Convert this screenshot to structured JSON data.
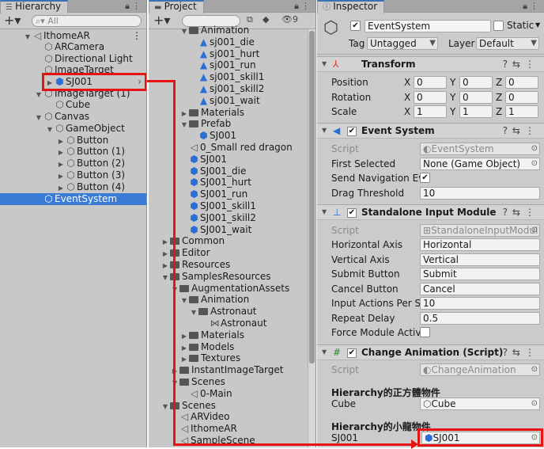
{
  "hierarchy": {
    "tab_label": "Hierarchy",
    "search_placeholder": "All",
    "rows": [
      {
        "label": "IthomeAR",
        "icon": "unity-scene-icon"
      },
      {
        "label": "ARCamera",
        "icon": "gameobject-cube-icon"
      },
      {
        "label": "Directional Light",
        "icon": "gameobject-cube-icon"
      },
      {
        "label": "ImageTarget",
        "icon": "gameobject-cube-icon"
      },
      {
        "label": "SJ001",
        "icon": "prefab-cube-icon"
      },
      {
        "label": "ImageTarget (1)",
        "icon": "gameobject-cube-icon"
      },
      {
        "label": "Cube",
        "icon": "gameobject-cube-icon"
      },
      {
        "label": "Canvas",
        "icon": "gameobject-cube-icon"
      },
      {
        "label": "GameObject",
        "icon": "gameobject-cube-icon"
      },
      {
        "label": "Button",
        "icon": "gameobject-cube-icon"
      },
      {
        "label": "Button (1)",
        "icon": "gameobject-cube-icon"
      },
      {
        "label": "Button (2)",
        "icon": "gameobject-cube-icon"
      },
      {
        "label": "Button (3)",
        "icon": "gameobject-cube-icon"
      },
      {
        "label": "Button (4)",
        "icon": "gameobject-cube-icon"
      },
      {
        "label": "EventSystem",
        "icon": "gameobject-cube-icon"
      }
    ]
  },
  "project": {
    "tab_label": "Project",
    "hidden_count": "9",
    "rows": [
      {
        "label": "Animation",
        "icon": "folder-icon"
      },
      {
        "label": "sj001_die",
        "icon": "animation-clip-icon"
      },
      {
        "label": "sj001_hurt",
        "icon": "animation-clip-icon"
      },
      {
        "label": "sj001_run",
        "icon": "animation-clip-icon"
      },
      {
        "label": "sj001_skill1",
        "icon": "animation-clip-icon"
      },
      {
        "label": "sj001_skill2",
        "icon": "animation-clip-icon"
      },
      {
        "label": "sj001_wait",
        "icon": "animation-clip-icon"
      },
      {
        "label": "Materials",
        "icon": "folder-icon"
      },
      {
        "label": "Prefab",
        "icon": "folder-icon"
      },
      {
        "label": "SJ001",
        "icon": "prefab-cube-icon"
      },
      {
        "label": "0_Small red dragon",
        "icon": "scene-icon"
      },
      {
        "label": "SJ001",
        "icon": "model-icon"
      },
      {
        "label": "SJ001_die",
        "icon": "model-icon"
      },
      {
        "label": "SJ001_hurt",
        "icon": "model-icon"
      },
      {
        "label": "SJ001_run",
        "icon": "model-icon"
      },
      {
        "label": "SJ001_skill1",
        "icon": "model-icon"
      },
      {
        "label": "SJ001_skill2",
        "icon": "model-icon"
      },
      {
        "label": "SJ001_wait",
        "icon": "model-icon"
      },
      {
        "label": "Common",
        "icon": "folder-icon"
      },
      {
        "label": "Editor",
        "icon": "folder-icon"
      },
      {
        "label": "Resources",
        "icon": "folder-icon"
      },
      {
        "label": "SamplesResources",
        "icon": "folder-icon"
      },
      {
        "label": "AugmentationAssets",
        "icon": "folder-icon"
      },
      {
        "label": "Animation",
        "icon": "folder-icon"
      },
      {
        "label": "Astronaut",
        "icon": "folder-icon"
      },
      {
        "label": "Astronaut",
        "icon": "animator-icon"
      },
      {
        "label": "Materials",
        "icon": "folder-icon"
      },
      {
        "label": "Models",
        "icon": "folder-icon"
      },
      {
        "label": "Textures",
        "icon": "folder-icon"
      },
      {
        "label": "InstantImageTarget",
        "icon": "folder-icon"
      },
      {
        "label": "Scenes",
        "icon": "folder-icon"
      },
      {
        "label": "0-Main",
        "icon": "scene-icon"
      },
      {
        "label": "Scenes",
        "icon": "folder-icon"
      },
      {
        "label": "ARVideo",
        "icon": "scene-icon"
      },
      {
        "label": "IthomeAR",
        "icon": "scene-icon"
      },
      {
        "label": "SampleScene",
        "icon": "scene-icon"
      }
    ]
  },
  "inspector": {
    "tab_label": "Inspector",
    "object_name": "EventSystem",
    "static_label": "Static",
    "tag_label": "Tag",
    "tag_value": "Untagged",
    "layer_label": "Layer",
    "layer_value": "Default",
    "transform": {
      "title": "Transform",
      "position_label": "Position",
      "rotation_label": "Rotation",
      "scale_label": "Scale",
      "x_label": "X",
      "y_label": "Y",
      "z_label": "Z",
      "position": [
        "0",
        "0",
        "0"
      ],
      "rotation": [
        "0",
        "0",
        "0"
      ],
      "scale": [
        "1",
        "1",
        "1"
      ]
    },
    "event_system": {
      "title": "Event System",
      "script_label": "Script",
      "script_value": "EventSystem",
      "first_selected_label": "First Selected",
      "first_selected_value": "None (Game Object)",
      "send_nav_label": "Send Navigation Eve",
      "drag_threshold_label": "Drag Threshold",
      "drag_threshold_value": "10"
    },
    "standalone": {
      "title": "Standalone Input Module",
      "script_label": "Script",
      "script_value": "StandaloneInputModul",
      "h_axis_label": "Horizontal Axis",
      "h_axis_value": "Horizontal",
      "v_axis_label": "Vertical Axis",
      "v_axis_value": "Vertical",
      "submit_label": "Submit Button",
      "submit_value": "Submit",
      "cancel_label": "Cancel Button",
      "cancel_value": "Cancel",
      "iaps_label": "Input Actions Per Sec",
      "iaps_value": "10",
      "repeat_label": "Repeat Delay",
      "repeat_value": "0.5",
      "force_label": "Force Module Active"
    },
    "change_anim": {
      "title": "Change Animation (Script)",
      "script_label": "Script",
      "script_value": "ChangeAnimation",
      "header1": "Hierarchy的正方體物件",
      "cube_label": "Cube",
      "cube_value": "Cube",
      "header2": "Hierarchy的小龍物件",
      "sj_label": "SJ001",
      "sj_value": "SJ001"
    }
  },
  "colors": {
    "selection": "#3a7bd5",
    "highlight_red": "#e41414",
    "panel_bg": "#c8c8c8"
  }
}
